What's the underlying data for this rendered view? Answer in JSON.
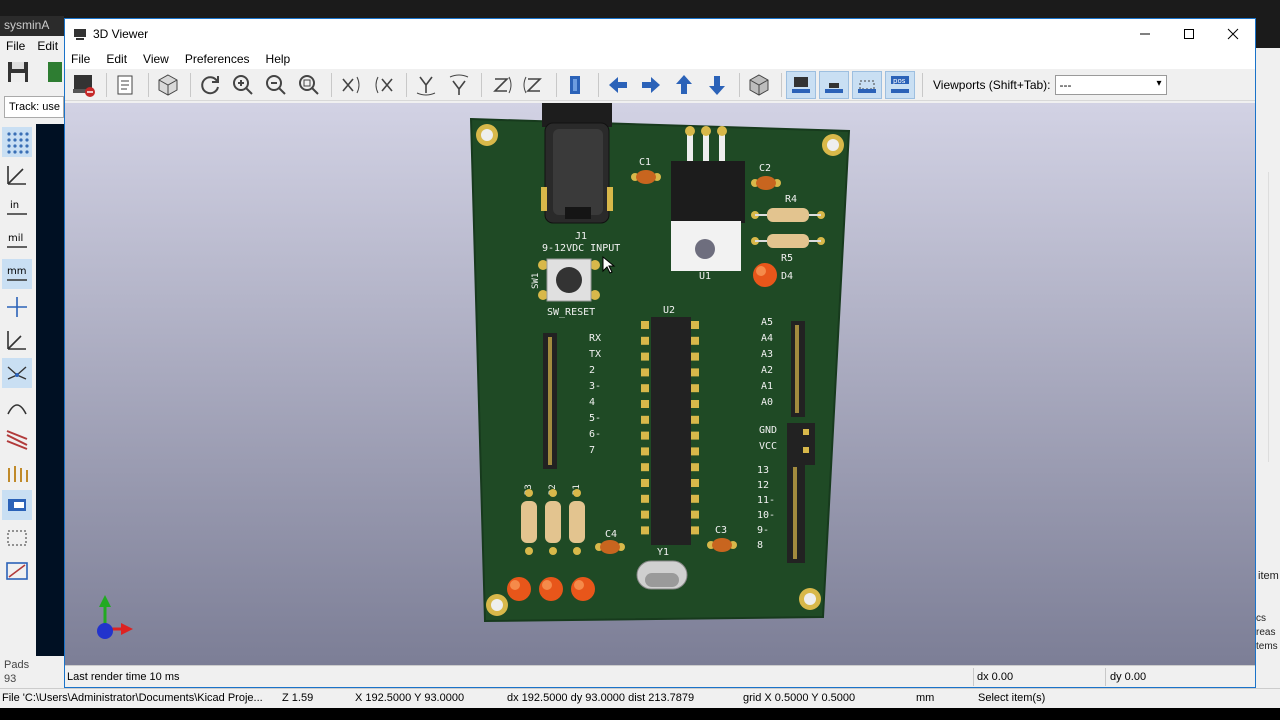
{
  "background_app": {
    "title": "sysminA",
    "menu": [
      "File",
      "Edit"
    ],
    "track_text": "Track: use n",
    "pads_label": "Pads",
    "pads_value": "93",
    "right_texts": [
      "item",
      "cs",
      "reas",
      "tems"
    ]
  },
  "viewer": {
    "title": "3D Viewer",
    "menu": [
      "File",
      "Edit",
      "View",
      "Preferences",
      "Help"
    ],
    "viewports_label": "Viewports (Shift+Tab):",
    "viewports_value": "---",
    "status": {
      "render_time": "Last render time 10 ms",
      "dx": "dx 0.00",
      "dy": "dy 0.00"
    }
  },
  "pcb": {
    "labels": {
      "j1": "J1",
      "input": "9-12VDC INPUT",
      "sw1": "SW1",
      "sw_reset": "SW_RESET",
      "c1": "C1",
      "c2": "C2",
      "c3": "C3",
      "c4": "C4",
      "r1": "R1",
      "r2": "R2",
      "r3": "R3",
      "r4": "R4",
      "r5": "R5",
      "u1": "U1",
      "u2": "U2",
      "y1": "Y1",
      "d4": "D4",
      "left_pins": [
        "RX",
        "TX",
        "2",
        "3-",
        "4",
        "5-",
        "6-",
        "7"
      ],
      "analog_pins": [
        "A5",
        "A4",
        "A3",
        "A2",
        "A1",
        "A0"
      ],
      "power_pins": [
        "GND",
        "VCC"
      ],
      "digital_pins": [
        "13",
        "12",
        "11-",
        "10-",
        "9-",
        "8"
      ]
    }
  },
  "statusbar": {
    "file": "File 'C:\\Users\\Administrator\\Documents\\Kicad Proje...",
    "zoom": "Z 1.59",
    "pos": "X 192.5000  Y 93.0000",
    "delta": "dx 192.5000  dy 93.0000  dist 213.7879",
    "grid": "grid X 0.5000  Y 0.5000",
    "units": "mm",
    "action": "Select item(s)"
  },
  "colors": {
    "board": "#1f4a25",
    "silkscreen": "#f2f2f2",
    "pad_gold": "#d8b84a",
    "led_orange": "#e8561a",
    "viewport_top": "#d2d2e4",
    "viewport_bottom": "#7c7e96",
    "accent": "#1a73c9"
  }
}
